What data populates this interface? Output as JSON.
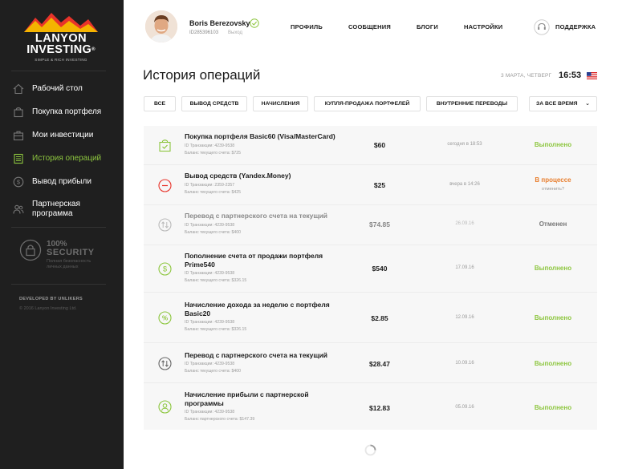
{
  "brand": {
    "line1": "LANYON",
    "line2": "INVESTING",
    "reg": "®",
    "tagline": "SIMPLE & RICH INVESTING"
  },
  "sidebar": {
    "items": [
      {
        "label": "Рабочий стол",
        "icon": "home-icon",
        "active": false
      },
      {
        "label": "Покупка портфеля",
        "icon": "cart-icon",
        "active": false
      },
      {
        "label": "Мои инвестиции",
        "icon": "briefcase-icon",
        "active": false
      },
      {
        "label": "История операций",
        "icon": "list-icon",
        "active": true
      },
      {
        "label": "Вывод прибыли",
        "icon": "dollar-icon",
        "active": false
      },
      {
        "label": "Партнерская программа",
        "icon": "partners-icon",
        "active": false
      }
    ],
    "security": {
      "percent": "100%",
      "word": "SECURITY",
      "desc": "Полная безопасность личных данных"
    },
    "developed": "DEVELOPED BY UNLIKERS",
    "copyright": "© 2016 Lanyon Investing Ltd."
  },
  "header": {
    "user_name": "Boris Berezovsky",
    "user_id": "ID285396103",
    "logout": "Выход",
    "nav": [
      "ПРОФИЛЬ",
      "СООБЩЕНИЯ",
      "БЛОГИ",
      "НАСТРОЙКИ"
    ],
    "support": "ПОДДЕРЖКА"
  },
  "page": {
    "title": "История операций",
    "date": "3 МАРТА, ЧЕТВЕРГ",
    "time": "16:53"
  },
  "filters": {
    "items": [
      "ВСЕ",
      "ВЫВОД СРЕДСТВ",
      "НАЧИСЛЕНИЯ",
      "КУПЛЯ-ПРОДАЖА ПОРТФЕЛЕЙ",
      "ВНУТРЕННИЕ ПЕРЕВОДЫ"
    ],
    "period": "ЗА ВСЕ ВРЕМЯ"
  },
  "colors": {
    "accent_green": "#8dc63f",
    "in_progress": "#e87e2e",
    "cancelled": "#777777",
    "sidebar_bg": "#1f1f1f"
  },
  "operations": [
    {
      "title": "Покупка портфеля Basic60 (Visa/MasterCard)",
      "txn": "ID Транзакции: 4239-9538",
      "balance": "Баланс текущего счета: $725",
      "amount": "$60",
      "date": "сегодня в 18:53",
      "status": "Выполнено",
      "status_type": "done",
      "icon": "cart-check-icon"
    },
    {
      "title": "Вывод средств (Yandex.Money)",
      "txn": "ID Транзакции: 2359-2357",
      "balance": "Баланс текущего счета: $425",
      "amount": "$25",
      "date": "вчера в 14:26",
      "status": "В процессе",
      "sub_status": "отменить?",
      "status_type": "progress",
      "icon": "minus-circle-icon"
    },
    {
      "title": "Перевод с партнерского счета на текущий",
      "txn": "ID Транзакции: 4239-9538",
      "balance": "Баланс текущего счета: $400",
      "amount": "$74.85",
      "date": "26.09.16",
      "status": "Отменен",
      "status_type": "cancelled",
      "icon": "transfer-icon"
    },
    {
      "title": "Пополнение счета от продажи портфеля Prime540",
      "txn": "ID Транзакции: 4239-9538",
      "balance": "Баланс текущего счета: $326.15",
      "amount": "$540",
      "date": "17.09.16",
      "status": "Выполнено",
      "status_type": "done",
      "icon": "dollar-circle-icon"
    },
    {
      "title": "Начисление дохода за неделю с портфеля Basic20",
      "txn": "ID Транзакции: 4239-9538",
      "balance": "Баланс текущего счета: $326.15",
      "amount": "$2.85",
      "date": "12.09.16",
      "status": "Выполнено",
      "status_type": "done",
      "icon": "percent-circle-icon"
    },
    {
      "title": "Перевод с партнерского счета на текущий",
      "txn": "ID Транзакции: 4239-9538",
      "balance": "Баланс текущего счета: $400",
      "amount": "$28.47",
      "date": "10.09.16",
      "status": "Выполнено",
      "status_type": "done",
      "icon": "transfer-icon"
    },
    {
      "title": "Начисление прибыли с партнерской программы",
      "txn": "ID Транзакции: 4239-9538",
      "balance": "Баланс партнерского счета: $147.39",
      "amount": "$12.83",
      "date": "05.09.16",
      "status": "Выполнено",
      "status_type": "done",
      "icon": "partner-circle-icon"
    }
  ]
}
